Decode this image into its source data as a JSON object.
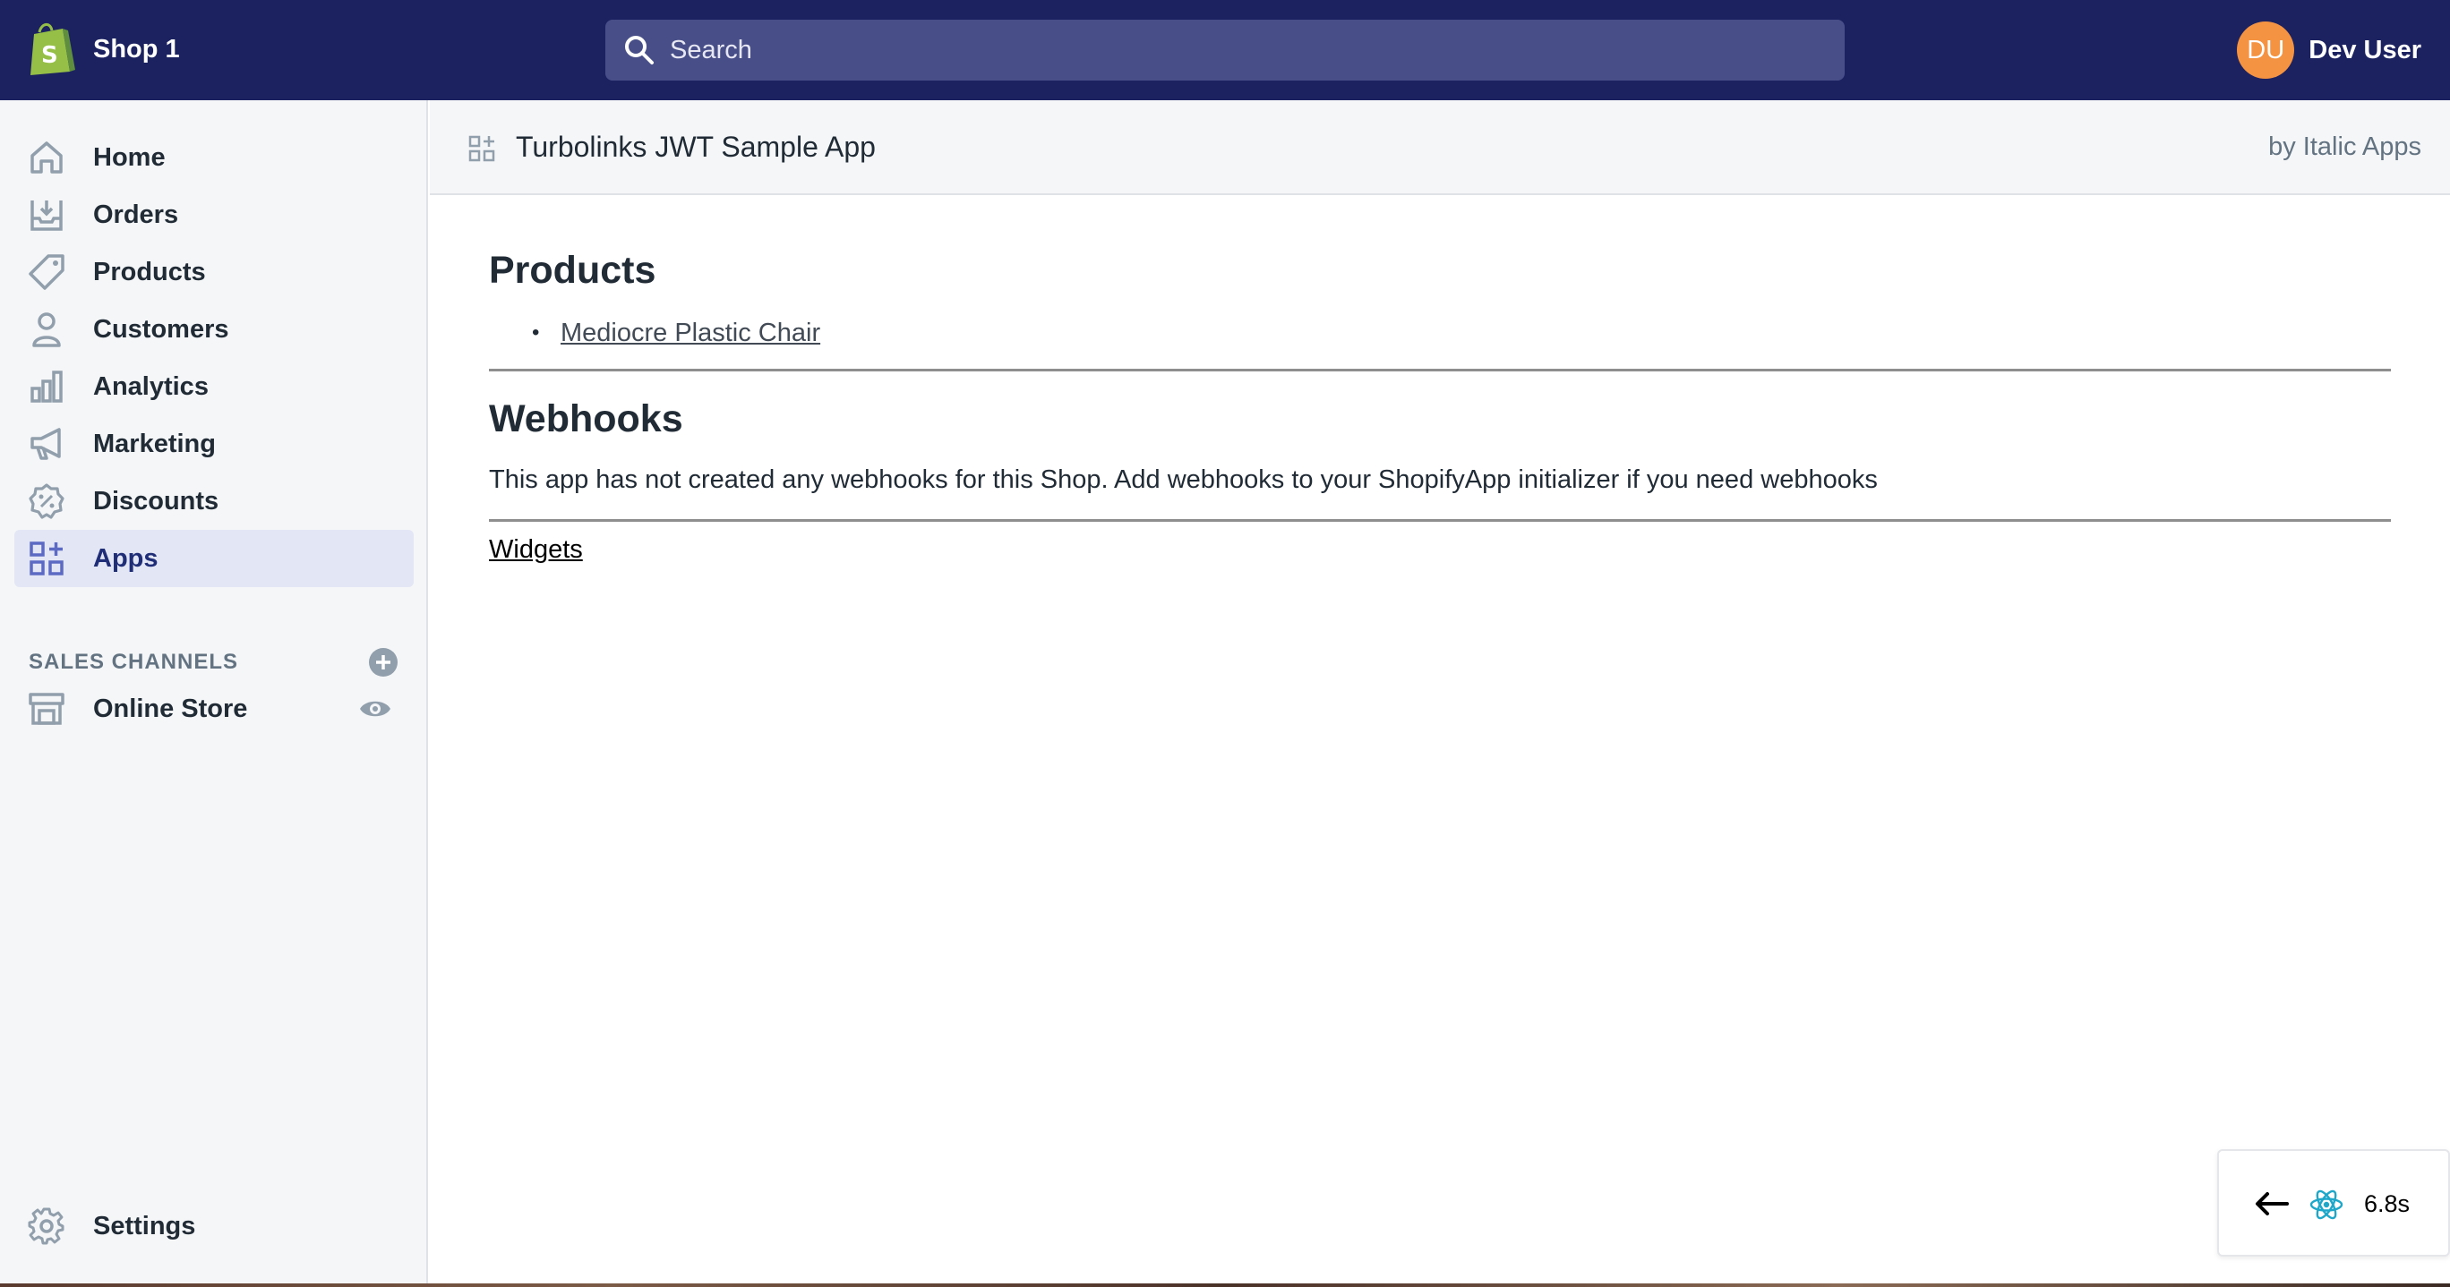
{
  "topbar": {
    "shop_name": "Shop 1",
    "search_placeholder": "Search",
    "avatar_initials": "DU",
    "user_name": "Dev User"
  },
  "sidebar": {
    "items": [
      {
        "label": "Home",
        "icon": "home-icon"
      },
      {
        "label": "Orders",
        "icon": "orders-icon"
      },
      {
        "label": "Products",
        "icon": "tag-icon"
      },
      {
        "label": "Customers",
        "icon": "person-icon"
      },
      {
        "label": "Analytics",
        "icon": "bar-chart-icon"
      },
      {
        "label": "Marketing",
        "icon": "megaphone-icon"
      },
      {
        "label": "Discounts",
        "icon": "discount-icon"
      },
      {
        "label": "Apps",
        "icon": "apps-icon",
        "active": true
      }
    ],
    "sales_channels_title": "SALES CHANNELS",
    "online_store_label": "Online Store",
    "settings_label": "Settings"
  },
  "header": {
    "app_title": "Turbolinks JWT Sample App",
    "app_author": "by Italic Apps"
  },
  "main": {
    "products_heading": "Products",
    "products": [
      "Mediocre Plastic Chair"
    ],
    "webhooks_heading": "Webhooks",
    "webhooks_text": "This app has not created any webhooks for this Shop. Add webhooks to your ShopifyApp initializer if you need webhooks",
    "widgets_link": "Widgets"
  },
  "perf_widget": {
    "time": "6.8s"
  },
  "colors": {
    "topbar": "#1c2260",
    "search_bg": "#474e88",
    "avatar": "#f49342",
    "sidebar_bg": "#f4f6f8",
    "active_item": "#e3e6f4",
    "shopify_green": "#95bf47",
    "react_blue": "#1fa7c9"
  }
}
